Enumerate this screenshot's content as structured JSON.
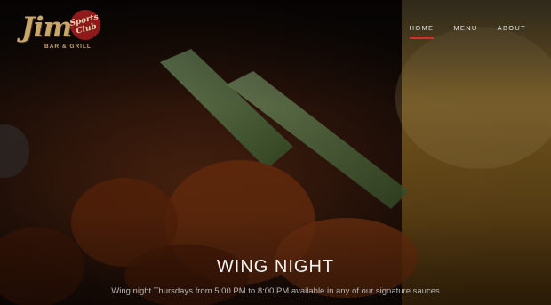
{
  "brand": {
    "script": "Jim's",
    "seal_line1": "Sports",
    "seal_line2": "Club",
    "tagline": "BAR & GRILL"
  },
  "nav": {
    "items": [
      {
        "label": "HOME",
        "active": true
      },
      {
        "label": "MENU",
        "active": false
      },
      {
        "label": "ABOUT",
        "active": false
      }
    ]
  },
  "hero": {
    "title": "WING NIGHT",
    "subtitle": "Wing night Thursdays from 5:00 PM to 8:00 PM available in any of our signature sauces"
  },
  "colors": {
    "accent": "#d0312d",
    "brand_gold": "#c9a66b",
    "brand_red": "#8e1a1c"
  }
}
